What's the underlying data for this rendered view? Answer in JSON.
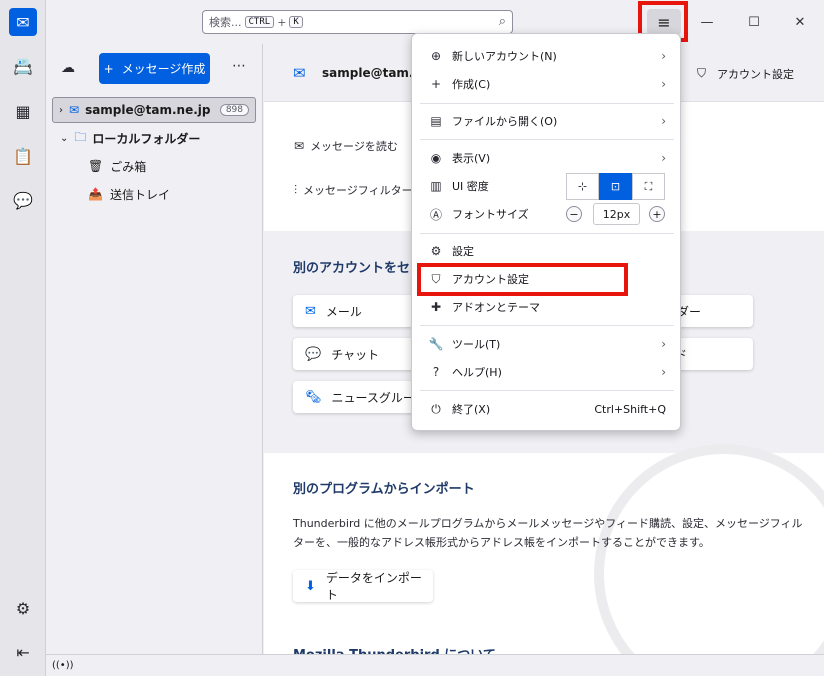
{
  "search": {
    "placeholder_text": "検索...",
    "key_ctrl": "CTRL",
    "plus": "+",
    "key_k": "K"
  },
  "colors": {
    "accent": "#0060df",
    "highlight": "#e8150c",
    "heading": "#1f3a68"
  },
  "window": {
    "menu_icon": "hamburger-icon",
    "minimize": "—",
    "maximize": "☐",
    "close": "✕"
  },
  "folderpane": {
    "write_button": "メッセージ作成",
    "write_plus": "+",
    "more": "⋯",
    "account": {
      "name": "sample@tam.ne.jp",
      "unread": "898"
    },
    "local": "ローカルフォルダー",
    "trash": "ごみ箱",
    "outbox": "送信トレイ"
  },
  "main": {
    "account_title": "sample@tam.",
    "account_settings": "アカウント設定",
    "read_messages": "メッセージを読む",
    "message_filters": "メッセージフィルターを",
    "setup_heading": "別のアカウントをセット",
    "cards_left": [
      "メール",
      "チャット",
      "ニュースグループ"
    ],
    "cards_right": [
      "ダー",
      "ド"
    ],
    "import_heading": "別のプログラムからインポート",
    "import_text": "Thunderbird に他のメールプログラムからメールメッセージやフィード購読、設定、メッセージフィルターを、一般的なアドレス帳形式からアドレス帳をインポートすることができます。",
    "import_button": "データをインポート",
    "about_heading": "Mozilla Thunderbird について"
  },
  "appmenu": {
    "new_account": "新しいアカウント(N)",
    "create": "作成(C)",
    "open_file": "ファイルから開く(O)",
    "view": "表示(V)",
    "ui_density": "UI 密度",
    "font_size": "フォントサイズ",
    "font_size_value": "12px",
    "settings": "設定",
    "account_settings": "アカウント設定",
    "addons": "アドオンとテーマ",
    "tools": "ツール(T)",
    "help": "ヘルプ(H)",
    "quit": "終了(X)",
    "quit_shortcut": "Ctrl+Shift+Q"
  }
}
